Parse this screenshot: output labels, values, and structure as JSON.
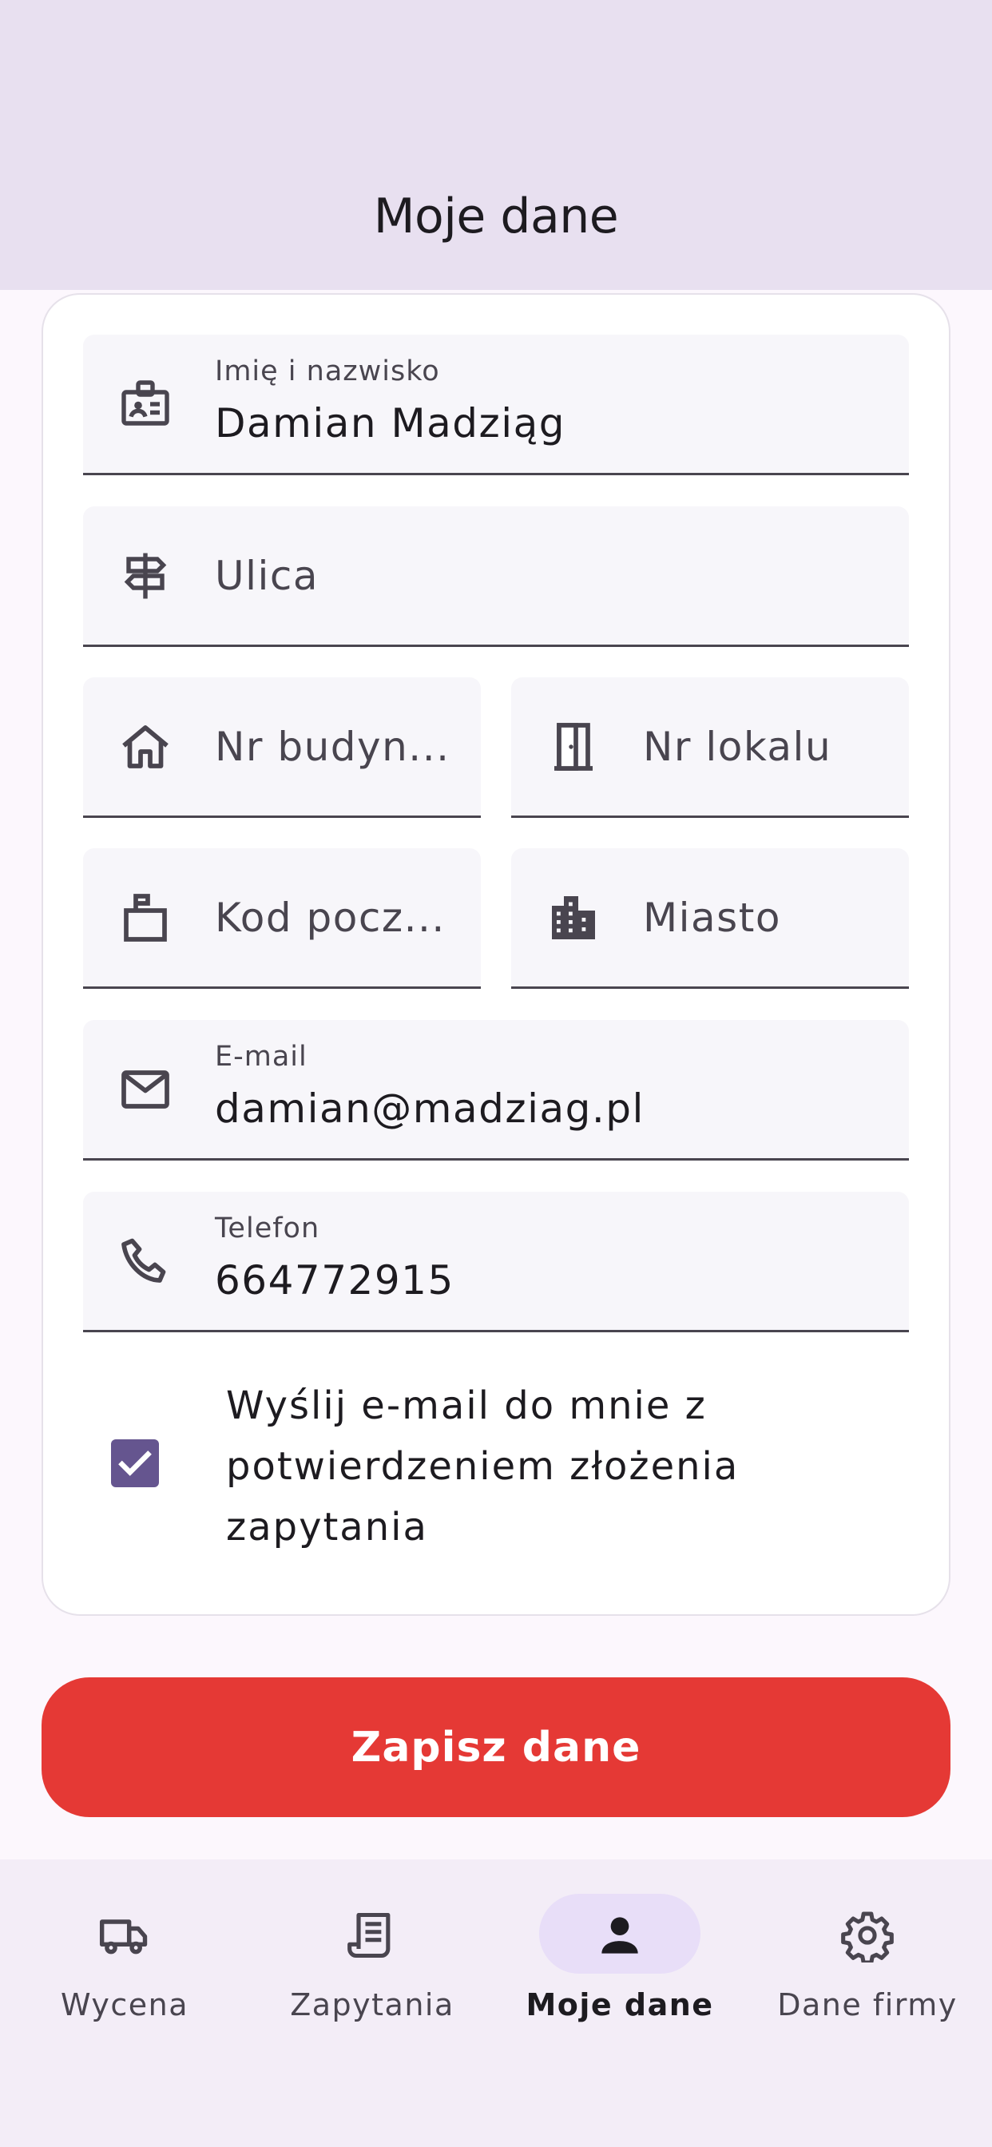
{
  "header": {
    "title": "Moje dane"
  },
  "form": {
    "name": {
      "label": "Imię i nazwisko",
      "value": "Damian Madziąg",
      "icon": "badge-icon"
    },
    "street": {
      "placeholder": "Ulica",
      "icon": "signpost-icon"
    },
    "building": {
      "placeholder": "Nr budyn...",
      "icon": "home-icon"
    },
    "apartment": {
      "placeholder": "Nr lokalu",
      "icon": "door-icon"
    },
    "postal_code": {
      "placeholder": "Kod pocz...",
      "icon": "mailbox-icon"
    },
    "city": {
      "placeholder": "Miasto",
      "icon": "city-icon"
    },
    "email": {
      "label": "E-mail",
      "value": "damian@madziag.pl",
      "icon": "mail-icon"
    },
    "phone": {
      "label": "Telefon",
      "value": "664772915",
      "icon": "phone-icon"
    },
    "confirm_checkbox": {
      "checked": true,
      "label": "Wyślij e-mail do mnie z potwierdzeniem złożenia zapytania"
    }
  },
  "save_button": {
    "label": "Zapisz dane"
  },
  "bottom_nav": {
    "items": [
      {
        "label": "Wycena",
        "icon": "truck-icon",
        "active": false
      },
      {
        "label": "Zapytania",
        "icon": "receipt-icon",
        "active": false
      },
      {
        "label": "Moje dane",
        "icon": "person-icon",
        "active": true
      },
      {
        "label": "Dane firmy",
        "icon": "gear-icon",
        "active": false
      }
    ]
  },
  "colors": {
    "header_bg": "#e8e0f0",
    "accent": "#65558f",
    "save_button": "#e53935",
    "nav_active_pill": "#e8def8"
  }
}
